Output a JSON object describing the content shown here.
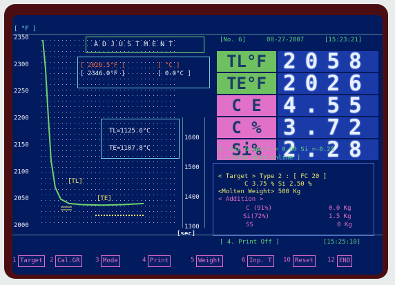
{
  "header": {
    "unit": "[ °F ]",
    "record": "[No.  6]",
    "date": "08-27-2007",
    "time": "[15:23:21]"
  },
  "mode_title": "ADJUSTMENT",
  "temp_readout": {
    "line1_f": "[ 2026.5°F ]",
    "line1_c": "[       °C ]",
    "line2_f": "[ 2346.0°F ]",
    "line2_c": "[    0.0°C ]"
  },
  "chart_data": {
    "type": "line",
    "y_ticks": [
      "2350",
      "2300",
      "2250",
      "2200",
      "2150",
      "2100",
      "2050",
      "2000"
    ],
    "x_ticks": [
      "1600",
      "1500",
      "1400",
      "1300"
    ],
    "x_unit": "[sec]",
    "ylim": [
      2000,
      2350
    ],
    "series": [
      {
        "values": [
          2345,
          2290,
          2200,
          2120,
          2070,
          2048,
          2040,
          2038,
          2037,
          2038,
          2040
        ]
      }
    ],
    "annotations": {
      "tl_marker": "[TL]",
      "te_marker": "[TE]"
    },
    "summary": {
      "tl": "TL=1125.6°C",
      "te": "TE=1107.8°C"
    },
    "grid": true
  },
  "readings": [
    {
      "label": "TL°F",
      "value": "2058",
      "color": "#6fc060"
    },
    {
      "label": "TE°F",
      "value": "2026",
      "color": "#6fc060"
    },
    {
      "label": "C E",
      "value": "4.55",
      "color": "#e070c8"
    },
    {
      "label": "C %",
      "value": "3.72",
      "color": "#e070c8"
    },
    {
      "label": "Si%",
      "value": "2.28",
      "color": "#e070c8"
    }
  ],
  "cal_graph": {
    "line1": "2. Cal.Graph  C = 0.00 Si =-0.25",
    "line2": "[ = Data disk online ]"
  },
  "target_panel": {
    "row1": "< Target >  Type 2 : [ FC 20 ]",
    "row2": "C  3.75 %      Si 2.50 %",
    "row3": "<Molten Weight>       500 Kg",
    "row4": "< Addition >",
    "add_c_label": "C (91%)",
    "add_c_val": "0.0 Kg",
    "add_si_label": "Si(72%)",
    "add_si_val": "1.5 Kg",
    "add_ss_label": "SS",
    "add_ss_val": "0 Kg"
  },
  "status_bar": {
    "print_state": "[ 4. Print  Off ]",
    "time": "[15:25:10]"
  },
  "function_keys": [
    {
      "num": "1",
      "label": "Target"
    },
    {
      "num": "2",
      "label": "Cal.GR"
    },
    {
      "num": "3",
      "label": "Mode"
    },
    {
      "num": "4",
      "label": "Print"
    },
    {
      "num": "5",
      "label": "Weight"
    },
    {
      "num": "6",
      "label": "Inp. T"
    },
    {
      "num": "10",
      "label": "Reset"
    },
    {
      "num": "12",
      "label": "END"
    }
  ]
}
